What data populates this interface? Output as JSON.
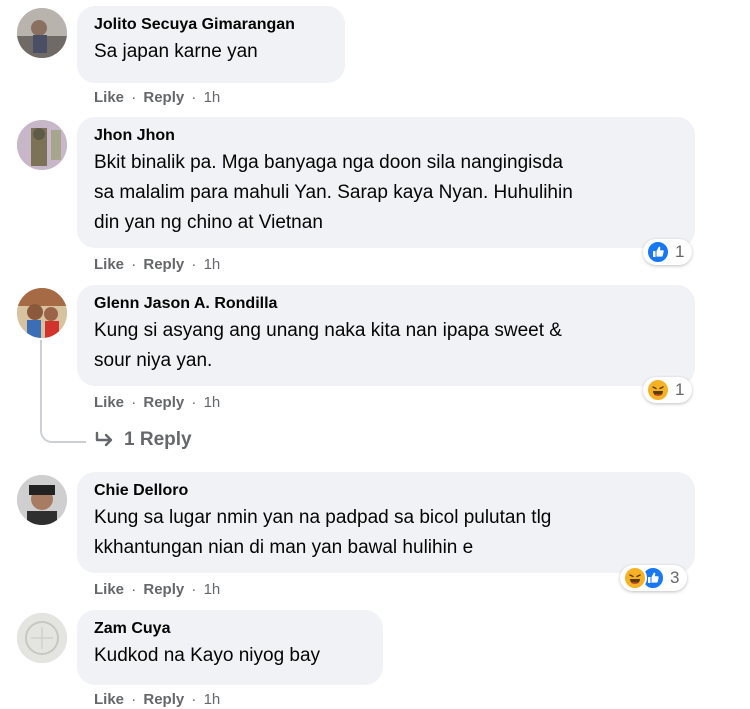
{
  "actions": {
    "like": "Like",
    "separator": "·",
    "reply": "Reply"
  },
  "comments": [
    {
      "author": "Jolito Secuya Gimarangan",
      "lines": [
        "Sa japan karne yan"
      ],
      "time": "1h"
    },
    {
      "author": "Jhon Jhon",
      "lines": [
        "Bkit binalik pa. Mga banyaga nga doon sila nangingisda",
        "sa malalim para mahuli Yan. Sarap kaya Nyan. Huhulihin",
        "din yan ng chino at Vietnan"
      ],
      "time": "1h",
      "reaction_count": "1",
      "reactions": [
        "like"
      ]
    },
    {
      "author": "Glenn Jason A. Rondilla",
      "lines": [
        "Kung si asyang ang unang naka kita nan ipapa sweet &",
        "sour niya yan."
      ],
      "time": "1h",
      "reaction_count": "1",
      "reactions": [
        "haha"
      ]
    },
    {
      "author": "Chie Delloro",
      "lines": [
        "Kung sa lugar nmin yan na padpad sa bicol pulutan tlg",
        "kkhantungan nian di man yan bawal hulihin e"
      ],
      "time": "1h",
      "reaction_count": "3",
      "reactions": [
        "haha",
        "like"
      ]
    },
    {
      "author": "Zam Cuya",
      "lines": [
        "Kudkod na Kayo niyog bay"
      ],
      "time": "1h"
    }
  ],
  "view_replies": "1 Reply",
  "colors": {
    "like_blue": "#1877f2",
    "haha_yellow": "#f7b125",
    "bubble_bg": "#f0f2f5",
    "meta_gray": "#65676b"
  }
}
